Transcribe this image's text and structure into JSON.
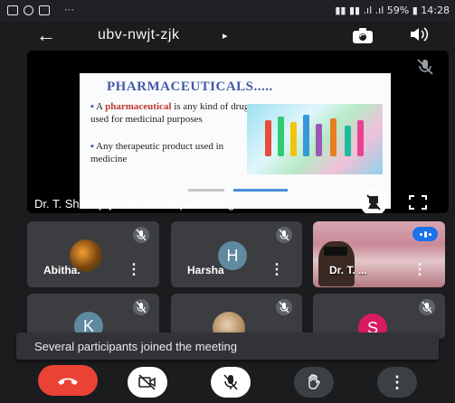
{
  "status_bar": {
    "left_icons": [
      "message-icon",
      "image-icon",
      "video-icon"
    ],
    "dots": "···",
    "right": "59% 14:28",
    "battery": "59%",
    "time": "14:28"
  },
  "header": {
    "meeting_code": "ubv-nwjt-zjk",
    "caret": "▸"
  },
  "presentation": {
    "slide": {
      "title": "PHARMACEUTICALS.....",
      "bullet1_pre": "A ",
      "bullet1_hl": "pharmaceutical",
      "bullet1_post": " is any kind of drug used for medicinal purposes",
      "bullet2": "Any therapeutic product used in medicine"
    },
    "presenter_text": "Dr. T. Shri Vijaya Kirubha is presenting"
  },
  "participants": [
    {
      "name": "Abitha.",
      "initial": "",
      "avatar": "photo",
      "muted": true
    },
    {
      "name": "Harsha",
      "initial": "H",
      "avatar_color": "#5f8aa0",
      "muted": true
    },
    {
      "name": "Dr. T. ...",
      "initial": "",
      "avatar": "video",
      "speaking": true
    },
    {
      "name": "",
      "initial": "K",
      "avatar_color": "#5f8aa0",
      "muted": true
    },
    {
      "name": "",
      "initial": "",
      "avatar": "photo",
      "muted": true
    },
    {
      "name": "",
      "initial": "S",
      "avatar_color": "#d81b60",
      "muted": true
    }
  ],
  "snackbar": {
    "text": "Several participants joined the meeting"
  },
  "controls": {
    "end_color": "#ea4335",
    "items": [
      "end-call",
      "camera-off",
      "mic-off",
      "raise-hand",
      "more-options"
    ]
  }
}
